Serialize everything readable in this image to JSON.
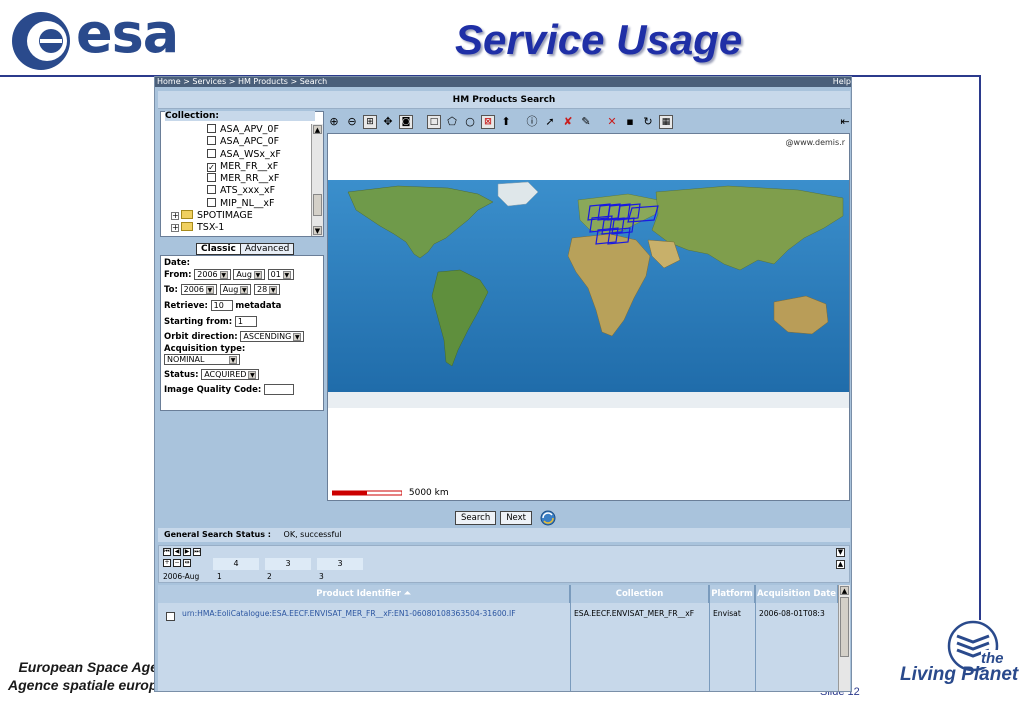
{
  "slide": {
    "logo_text": "esa",
    "title": "Service Usage",
    "footer_line1": "European Space Age",
    "footer_line2": "Agence spatiale europée",
    "slide_number": "Slide 12",
    "living_planet_the": "the",
    "living_planet_text": "Living Planet"
  },
  "app": {
    "breadcrumb": "Home > Services > HM Products > Search",
    "help": "Help",
    "title": "HM Products Search",
    "collection_label": "Collection:",
    "tree": [
      {
        "label": "ASA_APV_0F",
        "checked": false
      },
      {
        "label": "ASA_APC_0F",
        "checked": false
      },
      {
        "label": "ASA_WSx_xF",
        "checked": false
      },
      {
        "label": "MER_FR__xF",
        "checked": true
      },
      {
        "label": "MER_RR__xF",
        "checked": false
      },
      {
        "label": "ATS_xxx_xF",
        "checked": false
      },
      {
        "label": "MIP_NL__xF",
        "checked": false
      }
    ],
    "tree_folders": [
      "SPOTIMAGE",
      "TSX-1"
    ],
    "tabs": [
      "Classic",
      "Advanced"
    ],
    "form": {
      "date_label": "Date:",
      "from_label": "From:",
      "from_year": "2006",
      "from_month": "Aug",
      "from_day": "01",
      "to_label": "To:",
      "to_year": "2006",
      "to_month": "Aug",
      "to_day": "28",
      "retrieve_label": "Retrieve:",
      "retrieve_value": "10",
      "retrieve_unit": "metadata",
      "starting_label": "Starting from:",
      "starting_value": "1",
      "orbit_label": "Orbit direction:",
      "orbit_value": "ASCENDING",
      "acq_label": "Acquisition type:",
      "acq_value": "NOMINAL",
      "status_label": "Status:",
      "status_value": "ACQUIRED",
      "quality_label": "Image Quality Code:",
      "quality_value": ""
    },
    "map_credit": "@www.demis.r",
    "scale_label": "5000 km",
    "buttons": {
      "search": "Search",
      "next": "Next"
    },
    "status": {
      "label": "General Search Status :",
      "value": "OK, successful"
    },
    "timeline": {
      "counts": [
        "4",
        "3",
        "3"
      ],
      "ticks": [
        "2006-Aug",
        "1",
        "2",
        "3"
      ]
    },
    "table": {
      "columns": [
        "Product Identifier",
        "Collection",
        "Platform",
        "Acquisition Date"
      ],
      "sort_indicator": "⏶",
      "rows": [
        {
          "id": "urn:HMA:EoliCatalogue:ESA.EECF.ENVISAT_MER_FR__xF:EN1-06080108363504-31600.IF",
          "collection": "ESA.EECF.ENVISAT_MER_FR__xF",
          "platform": "Envisat",
          "date": "2006-08-01T08:3"
        }
      ]
    },
    "colors": {
      "panel": "#a9c3dc",
      "header": "#c7d8ea",
      "ocean": "#2a7ab8",
      "footprint": "#1a1ae0"
    }
  }
}
